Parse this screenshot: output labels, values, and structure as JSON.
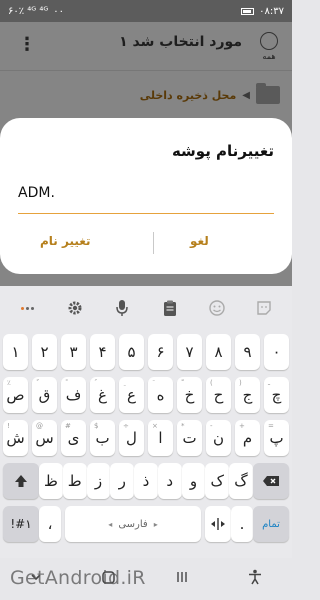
{
  "status_bar": {
    "time": "۰۸:۳۷",
    "indicators_left": "۶۰٪ ⁴ᴳ ⁴ᴳ",
    "percent_right": "۰۰"
  },
  "app": {
    "title": "۱ مورد انتخاب شد",
    "select_all_label": "همه",
    "breadcrumb_path": "محل ذخیره داخلی",
    "menu_glyph": "⋮"
  },
  "dialog": {
    "title": "تغییرنام پوشه",
    "input_value": ".ADM",
    "cancel_label": "لغو",
    "rename_label": "تغییر نام"
  },
  "keyboard": {
    "row_numbers": [
      "۱",
      "۲",
      "۳",
      "۴",
      "۵",
      "۶",
      "۷",
      "۸",
      "۹",
      "۰"
    ],
    "row1": [
      {
        "main": "ص",
        "sub": "٪"
      },
      {
        "main": "ق",
        "sub": "ٌ"
      },
      {
        "main": "ف",
        "sub": "ً"
      },
      {
        "main": "غ",
        "sub": "ُ"
      },
      {
        "main": "ع",
        "sub": "ِ"
      },
      {
        "main": "ه",
        "sub": "َ"
      },
      {
        "main": "خ",
        "sub": "ّ"
      },
      {
        "main": "ح",
        "sub": "("
      },
      {
        "main": "ج",
        "sub": ")"
      },
      {
        "main": "چ",
        "sub": "ـ"
      }
    ],
    "row2": [
      {
        "main": "ش",
        "sub": "!"
      },
      {
        "main": "س",
        "sub": "@"
      },
      {
        "main": "ی",
        "sub": "#"
      },
      {
        "main": "ب",
        "sub": "$"
      },
      {
        "main": "ل",
        "sub": "÷"
      },
      {
        "main": "ا",
        "sub": "×"
      },
      {
        "main": "ت",
        "sub": "*"
      },
      {
        "main": "ن",
        "sub": "-"
      },
      {
        "main": "م",
        "sub": "+"
      },
      {
        "main": "پ",
        "sub": "="
      }
    ],
    "row3": [
      {
        "main": "ظ",
        "sub": ""
      },
      {
        "main": "ط",
        "sub": ""
      },
      {
        "main": "ز",
        "sub": ""
      },
      {
        "main": "ر",
        "sub": ""
      },
      {
        "main": "ذ",
        "sub": ""
      },
      {
        "main": "د",
        "sub": ""
      },
      {
        "main": "و",
        "sub": ""
      },
      {
        "main": "ک",
        "sub": ""
      },
      {
        "main": "گ",
        "sub": ""
      }
    ],
    "symbols_label": "!#۱",
    "comma_label": "،",
    "space_label": "فارسی",
    "language_label": "◂▸",
    "period_label": ".",
    "enter_label": "تمام"
  },
  "watermark": "GetAndroid.iR"
}
